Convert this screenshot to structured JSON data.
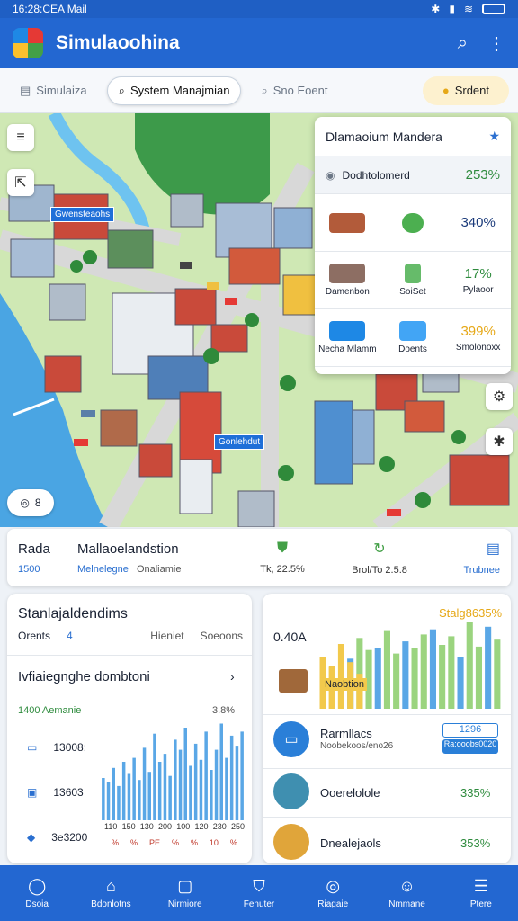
{
  "status": {
    "time": "16:28:CEA Mail",
    "icons": [
      "bluetooth-icon",
      "wifi-icon",
      "signal-icon",
      "battery-icon"
    ]
  },
  "app": {
    "title": "Simulaoohina"
  },
  "toolbar": {
    "items": [
      {
        "label": "Simulaiza",
        "icon": "layers-icon",
        "active": false
      },
      {
        "label": "System Manajmian",
        "icon": "search-icon",
        "active": true
      },
      {
        "label": "Sno Eoent",
        "icon": "search-icon",
        "active": false
      },
      {
        "label": "Srdent",
        "icon": "bulb-icon",
        "active": false
      }
    ]
  },
  "map": {
    "labels": [
      "Gwensteaohs",
      "Gonlehdut"
    ],
    "badge": "8"
  },
  "overlay": {
    "title": "Dlamaoium Mandera",
    "row1": {
      "label": "Dodhtolomerd",
      "value": "253%"
    },
    "cells": [
      {
        "label": "",
        "value": "",
        "color": "#b25b3a"
      },
      {
        "label": "",
        "value": "",
        "color": "#4caf50"
      },
      {
        "label": "",
        "value": "340%",
        "color": ""
      },
      {
        "label": "Damenbon",
        "value": "",
        "color": "#8d6e63"
      },
      {
        "label": "SoiSet",
        "value": "",
        "color": "#66bb6a"
      },
      {
        "label": "Pylaoor",
        "value": "17%",
        "color": ""
      },
      {
        "label": "Necha Mlamm",
        "value": "",
        "color": "#1e88e5"
      },
      {
        "label": "Doents",
        "value": "",
        "color": "#42a5f5"
      },
      {
        "label": "Smolonoxx",
        "value": "399%",
        "color": ""
      }
    ]
  },
  "summary": {
    "c1": {
      "top": "Rada",
      "sub": "1500"
    },
    "c2": {
      "top": "Mallaoelandstion",
      "sub": "Melnelegne",
      "sub2": "Onaliamie"
    },
    "c3": {
      "sub": "Tk, 22.5%"
    },
    "c4": {
      "sub": "Brol/To 2.5.8"
    },
    "c5": {
      "sub": "Trubnee"
    }
  },
  "left_panel": {
    "title": "Stanlajaldendims",
    "tabs": [
      "Orents",
      "Hieniet",
      "Soeoons"
    ],
    "tab_badge": "4",
    "section_title": "Ivfiaiegnghe dombtoni",
    "header_left": "1400 Aemanie",
    "header_right": "3.8%",
    "rows": [
      {
        "label": "13008:"
      },
      {
        "label": "13603"
      },
      {
        "label": "3e3200"
      }
    ],
    "x_labels": [
      "110",
      "150",
      "130",
      "200",
      "100",
      "120",
      "230",
      "250"
    ],
    "x_sub": [
      "%",
      "%",
      "PE",
      "%",
      "%",
      "10",
      "%"
    ]
  },
  "right_panel": {
    "top_left": "0.40A",
    "top_right": "Stalg8635%",
    "item_label": "Naobtion",
    "list": [
      {
        "title": "Rarmllacs",
        "sub": "Noobekoos/eno26",
        "value": "1296",
        "value_sub": "Ra:ooobs0020"
      },
      {
        "title": "Ooerelolole",
        "value": "335%"
      },
      {
        "title": "Dnealejaols",
        "value": "353%"
      }
    ]
  },
  "chart_data": [
    {
      "type": "bar",
      "title": "",
      "series": [
        {
          "name": "",
          "values": [
            42,
            38,
            52,
            34,
            58,
            46,
            62,
            40,
            72,
            48,
            86,
            58,
            66,
            44,
            80,
            70,
            92,
            54,
            76,
            60,
            88,
            50,
            70,
            96,
            62,
            84,
            74,
            88
          ]
        }
      ],
      "color": "#5aa7e6"
    },
    {
      "type": "bar",
      "title": "",
      "series": [
        {
          "name": "",
          "values": [
            40,
            55,
            35,
            60,
            45,
            50,
            70,
            42,
            58,
            48,
            52,
            65,
            45,
            60,
            50,
            55,
            48,
            62,
            52,
            58
          ]
        },
        {
          "name": "",
          "values": [
            60,
            48,
            75,
            58,
            82,
            68,
            70,
            90,
            64,
            78,
            70,
            86,
            92,
            74,
            84,
            60,
            100,
            72,
            95,
            80
          ]
        }
      ],
      "colors": [
        "#f2c94c",
        "#5aa7e6",
        "#9bd47f"
      ]
    }
  ],
  "nav": [
    {
      "label": "Dsoia",
      "icon": "home-icon"
    },
    {
      "label": "Bdonlotns",
      "icon": "house-icon"
    },
    {
      "label": "Nirmiore",
      "icon": "card-icon"
    },
    {
      "label": "Fenuter",
      "icon": "shield-icon"
    },
    {
      "label": "Riagaie",
      "icon": "globe-icon"
    },
    {
      "label": "Nmmane",
      "icon": "user-icon"
    },
    {
      "label": "Ptere",
      "icon": "menu-icon"
    }
  ]
}
